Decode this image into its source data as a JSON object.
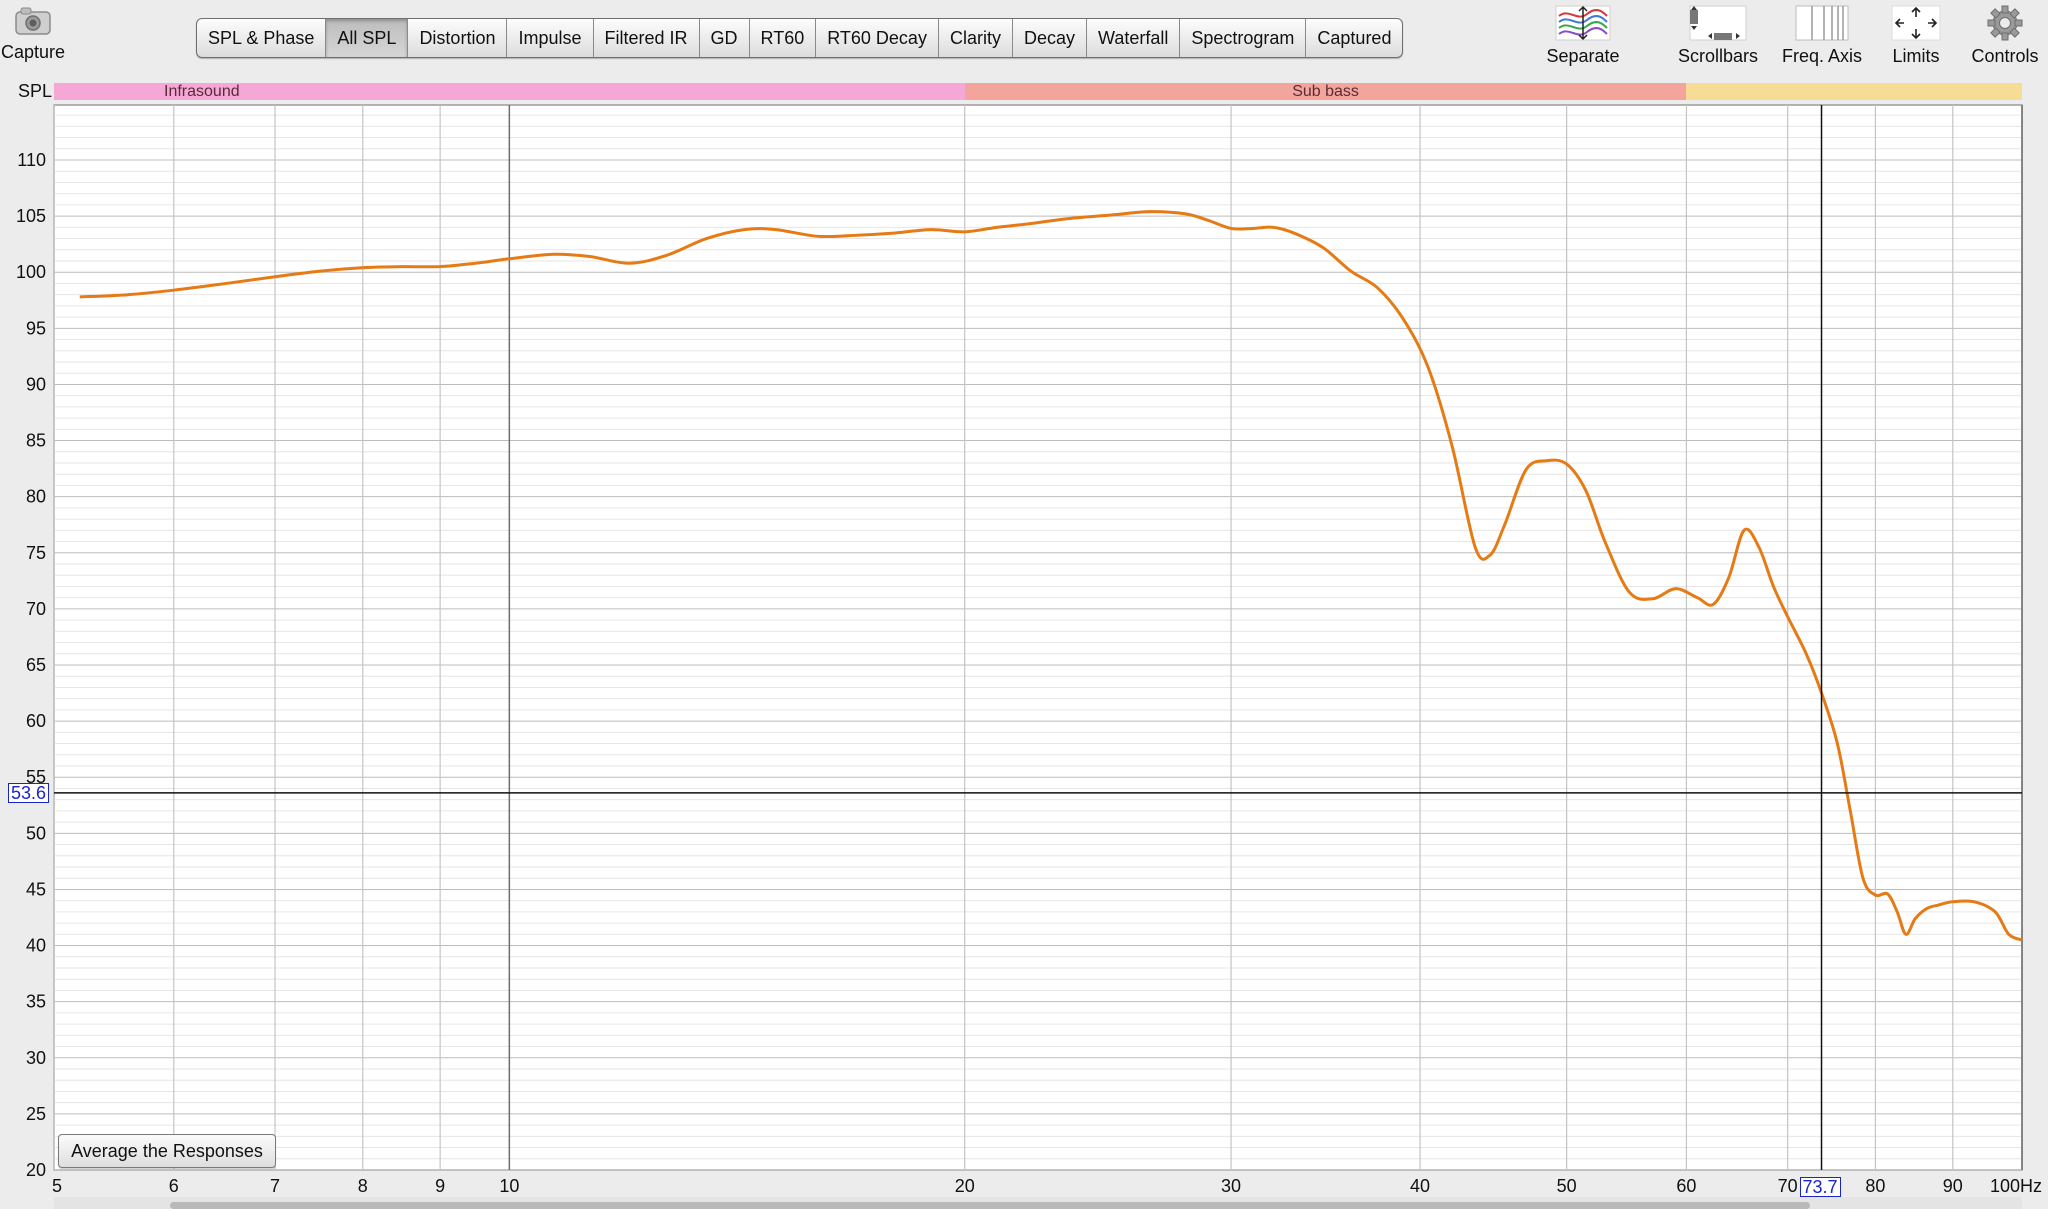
{
  "toolbar": {
    "capture_label": "Capture",
    "tabs": [
      {
        "label": "SPL & Phase",
        "selected": false
      },
      {
        "label": "All SPL",
        "selected": true
      },
      {
        "label": "Distortion",
        "selected": false
      },
      {
        "label": "Impulse",
        "selected": false
      },
      {
        "label": "Filtered IR",
        "selected": false
      },
      {
        "label": "GD",
        "selected": false
      },
      {
        "label": "RT60",
        "selected": false
      },
      {
        "label": "RT60 Decay",
        "selected": false
      },
      {
        "label": "Clarity",
        "selected": false
      },
      {
        "label": "Decay",
        "selected": false
      },
      {
        "label": "Waterfall",
        "selected": false
      },
      {
        "label": "Spectrogram",
        "selected": false
      },
      {
        "label": "Captured",
        "selected": false
      }
    ],
    "separate_label": "Separate",
    "scrollbars_label": "Scrollbars",
    "freq_axis_label": "Freq. Axis",
    "limits_label": "Limits",
    "controls_label": "Controls"
  },
  "bands": [
    {
      "label": "Infrasound",
      "from_hz": 5,
      "to_hz": 20,
      "color": "#f5a8d6"
    },
    {
      "label": "Sub bass",
      "from_hz": 20,
      "to_hz": 60,
      "color": "#f4a59b"
    },
    {
      "label": "",
      "from_hz": 60,
      "to_hz": 100,
      "color": "#f6dc95"
    }
  ],
  "chart": {
    "ylabel": "SPL",
    "average_button_label": "Average the Responses",
    "cursor": {
      "freq_readout": "73.7",
      "spl_readout": "53.6"
    }
  },
  "chart_data": {
    "type": "line",
    "x_scale": "log",
    "xlim": [
      5,
      100
    ],
    "ylim": [
      20,
      110
    ],
    "x_ticks": [
      5,
      6,
      7,
      8,
      9,
      10,
      20,
      30,
      40,
      50,
      60,
      70,
      80,
      90,
      100
    ],
    "x_tick_labels": [
      "5",
      "6",
      "7",
      "8",
      "9",
      "10",
      "20",
      "30",
      "40",
      "50",
      "60",
      "70",
      "",
      "80",
      "90",
      "100Hz"
    ],
    "y_ticks": [
      20,
      25,
      30,
      35,
      40,
      45,
      50,
      55,
      60,
      65,
      70,
      75,
      80,
      85,
      90,
      95,
      100,
      105,
      110
    ],
    "grid": true,
    "cursor": {
      "freq": 73.7,
      "spl": 53.6
    },
    "series": [
      {
        "color": "#e67a14",
        "x": [
          5.2,
          5.6,
          6.0,
          6.5,
          7.0,
          7.5,
          8.0,
          8.5,
          9.0,
          9.5,
          10.0,
          10.7,
          11.3,
          12.0,
          12.7,
          13.5,
          14.3,
          15.0,
          16.0,
          17.0,
          18.0,
          19.0,
          20.0,
          21.0,
          22.0,
          23.5,
          25.0,
          26.5,
          28.0,
          29.0,
          30.0,
          31.0,
          32.0,
          33.0,
          34.5,
          36.0,
          37.5,
          39.0,
          40.5,
          42.0,
          43.5,
          44.5,
          45.5,
          47.0,
          48.5,
          50.0,
          51.5,
          53.0,
          55.0,
          57.0,
          59.0,
          61.0,
          62.5,
          64.0,
          65.5,
          67.0,
          68.5,
          70.0,
          72.0,
          73.7,
          75.5,
          77.0,
          78.5,
          80.0,
          81.5,
          82.7,
          83.8,
          85.0,
          86.5,
          88.0,
          90.0,
          93.0,
          96.0,
          98.0,
          100.0
        ],
        "values": [
          97.8,
          98.0,
          98.4,
          99.0,
          99.6,
          100.1,
          100.4,
          100.5,
          100.5,
          100.8,
          101.2,
          101.6,
          101.4,
          100.8,
          101.5,
          103.0,
          103.8,
          103.8,
          103.2,
          103.3,
          103.5,
          103.8,
          103.6,
          104.0,
          104.3,
          104.8,
          105.1,
          105.4,
          105.2,
          104.6,
          103.9,
          103.9,
          104.0,
          103.5,
          102.2,
          100.1,
          98.6,
          95.8,
          91.5,
          84.5,
          75.5,
          74.8,
          77.5,
          82.4,
          83.2,
          82.9,
          80.5,
          76.0,
          71.5,
          70.9,
          71.8,
          71.0,
          70.4,
          72.8,
          77.0,
          75.5,
          72.0,
          69.3,
          66.0,
          62.5,
          58.0,
          52.0,
          46.0,
          44.5,
          44.6,
          43.0,
          41.0,
          42.4,
          43.3,
          43.6,
          43.9,
          43.9,
          43.0,
          41.0,
          40.5
        ]
      }
    ]
  }
}
